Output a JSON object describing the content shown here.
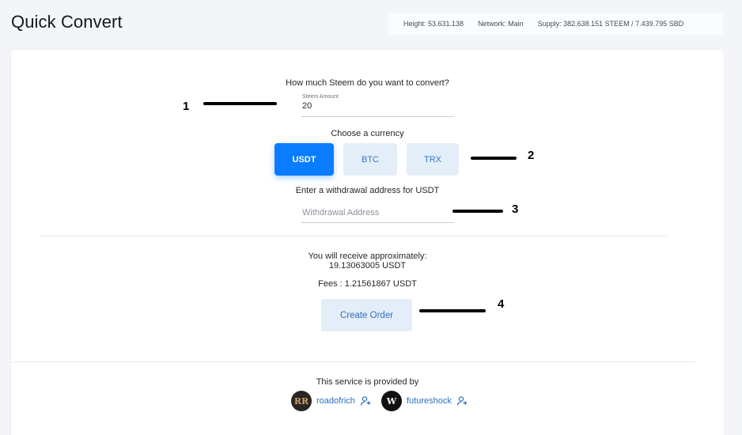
{
  "header": {
    "title": "Quick Convert",
    "status": {
      "height": "Height: 53.631.138",
      "network": "Network: Main",
      "supply": "Supply: 382.638.151 STEEM / 7.439.795 SBD"
    }
  },
  "form": {
    "amount_question": "How much Steem do you want to convert?",
    "amount_field": {
      "label": "Steem Amount",
      "value": "20"
    },
    "currency_question": "Choose a currency",
    "currencies": [
      {
        "label": "USDT",
        "selected": true
      },
      {
        "label": "BTC",
        "selected": false
      },
      {
        "label": "TRX",
        "selected": false
      }
    ],
    "address_question": "Enter a withdrawal address for USDT",
    "address_field": {
      "placeholder": "Withdrawal Address",
      "value": ""
    }
  },
  "summary": {
    "receive_label": "You will receive approximately:",
    "receive_amount": "19.13063005 USDT",
    "fees": "Fees : 1.21561867 USDT",
    "create_button": "Create Order"
  },
  "footer": {
    "provided_by": "This service is provided by",
    "providers": [
      {
        "name": "roadofrich",
        "avatar_text": "RR",
        "icon": "user-link-icon"
      },
      {
        "name": "futureshock",
        "avatar_text": "W",
        "icon": "user-link-icon"
      }
    ]
  },
  "annotations": [
    "1",
    "2",
    "3",
    "4"
  ],
  "colors": {
    "accent": "#0a7cff",
    "inactive_button_bg": "#e4eef8",
    "link": "#2f6fbf",
    "page_bg": "#f3f5f9"
  }
}
